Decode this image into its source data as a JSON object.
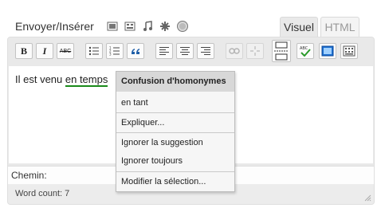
{
  "upload": {
    "label": "Envoyer/Insérer"
  },
  "media_icons": [
    "image-icon",
    "video-icon",
    "audio-icon",
    "media-icon",
    "circle-icon"
  ],
  "tabs": {
    "visual": "Visuel",
    "html": "HTML"
  },
  "toolbar": {
    "buttons": [
      "bold-icon",
      "italic-icon",
      "strikethrough-icon",
      "bullet-list-icon",
      "numbered-list-icon",
      "blockquote-icon",
      "align-left-icon",
      "align-center-icon",
      "align-right-icon",
      "link-icon",
      "unlink-icon",
      "more-tag-icon",
      "spellcheck-icon",
      "fullscreen-icon",
      "kitchen-sink-icon"
    ],
    "bold_label": "B",
    "italic_label": "I",
    "strike_label": "ABC",
    "quote_label": "“",
    "spell_label": "ABC"
  },
  "content": {
    "before": "Il est venu ",
    "highlighted": "en temps"
  },
  "context_menu": {
    "title": "Confusion d'homonymes",
    "suggestion": "en tant",
    "explain": "Expliquer...",
    "ignore_suggestion": "Ignorer la suggestion",
    "ignore_always": "Ignorer toujours",
    "edit_selection": "Modifier la sélection..."
  },
  "path": {
    "label": "Chemin:"
  },
  "status": {
    "word_count": "Word count: 7"
  }
}
